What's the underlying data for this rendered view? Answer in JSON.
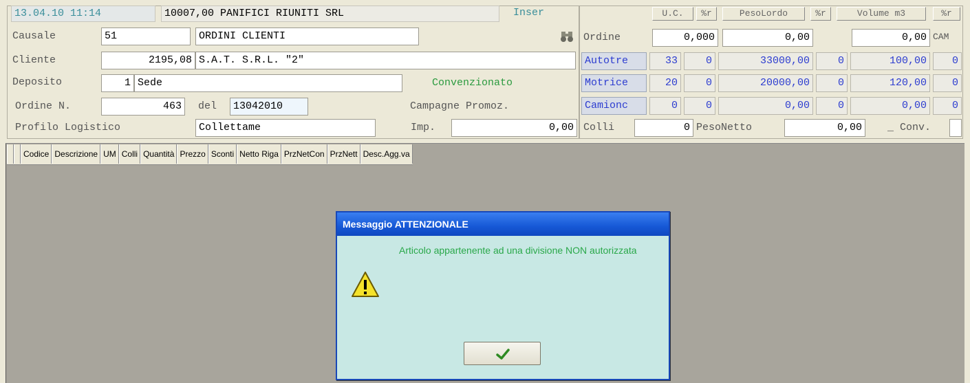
{
  "header": {
    "datetime": "13.04.10 11:14",
    "company_code": "10007,00",
    "company_name": "PANIFICI RIUNITI SRL",
    "mode": "Inser"
  },
  "form": {
    "causale_label": "Causale",
    "causale_code": "51",
    "causale_desc": "ORDINI CLIENTI",
    "cliente_label": "Cliente",
    "cliente_code": "2195,08",
    "cliente_name": "S.A.T. S.R.L. \"2\"",
    "deposito_label": "Deposito",
    "deposito_code": "1",
    "deposito_name": "Sede",
    "convenzionato": "Convenzionato",
    "ordine_label": "Ordine N.",
    "ordine_num": "463",
    "del_label": "del",
    "ordine_date": "13042010",
    "campagne_label": "Campagne Promoz.",
    "profilo_label": "Profilo Logistico",
    "profilo_value": "Collettame",
    "imp_label": "Imp.",
    "imp_value": "0,00"
  },
  "right": {
    "headers": {
      "uc": "U.C.",
      "pct1": "%r",
      "peso_lordo": "PesoLordo",
      "pct2": "%r",
      "volume": "Volume m3",
      "pct3": "%r"
    },
    "ordine_label": "Ordine",
    "ordine_uc": "0,000",
    "ordine_peso": "0,00",
    "ordine_volume": "0,00",
    "cam_label": "CAM",
    "rows": [
      {
        "label": "Autotre",
        "uc": "33",
        "p1": "0",
        "peso": "33000,00",
        "p2": "0",
        "volume": "100,00",
        "p3": "0"
      },
      {
        "label": "Motrice",
        "uc": "20",
        "p1": "0",
        "peso": "20000,00",
        "p2": "0",
        "volume": "120,00",
        "p3": "0"
      },
      {
        "label": "Camionc",
        "uc": "0",
        "p1": "0",
        "peso": "0,00",
        "p2": "0",
        "volume": "0,00",
        "p3": "0"
      }
    ],
    "colli_label": "Colli",
    "colli_value": "0",
    "peso_netto_label": "PesoNetto",
    "peso_netto_value": "0,00",
    "conv_label": "Conv."
  },
  "grid": {
    "columns": [
      "Codice",
      "Descrizione",
      "UM",
      "Colli",
      "Quantità",
      "Prezzo",
      "Sconti",
      "Netto Riga",
      "PrzNetCon",
      "PrzNett",
      "Desc.Agg.va"
    ]
  },
  "dialog": {
    "title": "Messaggio ATTENZIONALE",
    "message": "Articolo appartenente ad una divisione NON autorizzata",
    "ok_icon": "checkmark-icon",
    "warning_icon": "warning-icon"
  },
  "colors": {
    "dialog_title_bg": "#1a5fd8",
    "dialog_body_bg": "#c8e8e4",
    "message_text": "#2aa84a",
    "blue_value": "#2c3cd0",
    "window_bg": "#ece9d8",
    "grid_bg": "#a8a59c"
  }
}
